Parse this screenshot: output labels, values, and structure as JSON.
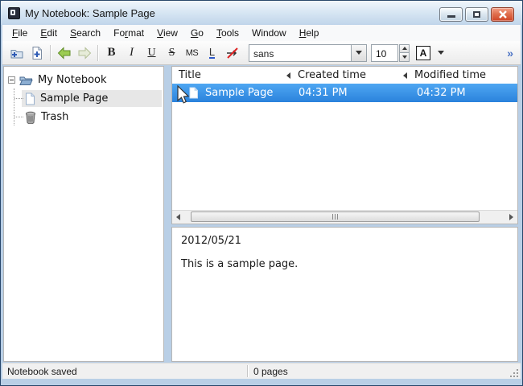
{
  "window": {
    "title": "My Notebook: Sample Page"
  },
  "menu": {
    "items": [
      {
        "pre": "",
        "mn": "F",
        "post": "ile"
      },
      {
        "pre": "",
        "mn": "E",
        "post": "dit"
      },
      {
        "pre": "",
        "mn": "S",
        "post": "earch"
      },
      {
        "pre": "Fo",
        "mn": "r",
        "post": "mat"
      },
      {
        "pre": "",
        "mn": "V",
        "post": "iew"
      },
      {
        "pre": "",
        "mn": "G",
        "post": "o"
      },
      {
        "pre": "",
        "mn": "T",
        "post": "ools"
      },
      {
        "pre": "Window",
        "mn": "",
        "post": ""
      },
      {
        "pre": "",
        "mn": "H",
        "post": "elp"
      }
    ]
  },
  "toolbar": {
    "bold": "B",
    "italic": "I",
    "underline": "U",
    "strikethrough": "S",
    "monospace": "MS",
    "link": "L",
    "font_family": "sans",
    "font_size": "10",
    "font_color": "A",
    "overflow": "»"
  },
  "tree": {
    "root": {
      "label": "My Notebook"
    },
    "items": [
      {
        "label": "Sample Page"
      },
      {
        "label": "Trash"
      }
    ]
  },
  "list": {
    "columns": [
      "Title",
      "Created time",
      "Modified time"
    ],
    "rows": [
      {
        "title": "Sample Page",
        "created": "04:31 PM",
        "modified": "04:32 PM"
      }
    ]
  },
  "editor": {
    "date_line": "2012/05/21",
    "body_line": "This is a sample page."
  },
  "statusbar": {
    "left": "Notebook saved",
    "pages": "0 pages"
  },
  "colors": {
    "selection_top": "#4fa7f2",
    "selection_bottom": "#2a82dc",
    "tree_selection": "#e7e7e7",
    "close_button": "#cf4526",
    "frame": "#b9cfe6",
    "back_arrow_green": "#9ccc52"
  }
}
